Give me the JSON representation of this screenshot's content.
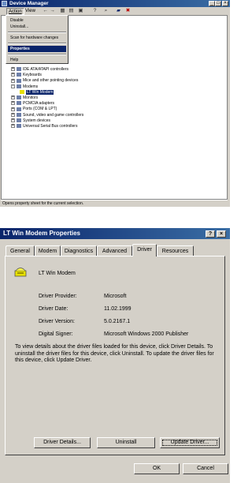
{
  "device_manager": {
    "title": "Device Manager",
    "menu": {
      "action": "Action",
      "view": "View"
    },
    "toolbar_icons": [
      "back-icon",
      "forward-icon",
      "view-icon",
      "properties-icon",
      "refresh-icon",
      "help-icon",
      "scan-icon",
      "disable-icon",
      "uninstall-icon"
    ],
    "action_menu": {
      "items": [
        "Disable",
        "Uninstall...",
        "Scan for hardware changes",
        "Properties",
        "Help"
      ],
      "highlighted": "Properties"
    },
    "tree": [
      {
        "label": "IDE ATA/ATAPI controllers",
        "expander": "+"
      },
      {
        "label": "Keyboards",
        "expander": "+"
      },
      {
        "label": "Mice and other pointing devices",
        "expander": "+"
      },
      {
        "label": "Modems",
        "expander": "-"
      },
      {
        "label": "LT Win Modem",
        "expander": ""
      },
      {
        "label": "Monitors",
        "expander": "+"
      },
      {
        "label": "PCMCIA adapters",
        "expander": "+"
      },
      {
        "label": "Ports (COM & LPT)",
        "expander": "+"
      },
      {
        "label": "Sound, video and game controllers",
        "expander": "+"
      },
      {
        "label": "System devices",
        "expander": "+"
      },
      {
        "label": "Universal Serial Bus controllers",
        "expander": "+"
      }
    ],
    "status": "Opens property sheet for the current selection.",
    "captions": {
      "minimize": "_",
      "maximize": "□",
      "close": "×"
    }
  },
  "properties": {
    "title": "LT Win Modem Properties",
    "captions": {
      "help": "?",
      "close": "×"
    },
    "tabs": [
      "General",
      "Modem",
      "Diagnostics",
      "Advanced",
      "Driver",
      "Resources"
    ],
    "active_tab": "Driver",
    "device_name": "LT Win Modem",
    "fields": [
      {
        "label": "Driver Provider:",
        "value": "Microsoft"
      },
      {
        "label": "Driver Date:",
        "value": "11.02.1999"
      },
      {
        "label": "Driver Version:",
        "value": "5.0.2167.1"
      },
      {
        "label": "Digital Signer:",
        "value": "Microsoft Windows 2000 Publisher"
      }
    ],
    "description": "To view details about the driver files loaded for this device, click Driver Details. To uninstall the driver files for this device, click Uninstall. To update the driver files for this device, click Update Driver.",
    "buttons": {
      "driver_details": "Driver Details...",
      "uninstall": "Uninstall",
      "update_driver": "Update Driver...",
      "ok": "OK",
      "cancel": "Cancel"
    }
  }
}
